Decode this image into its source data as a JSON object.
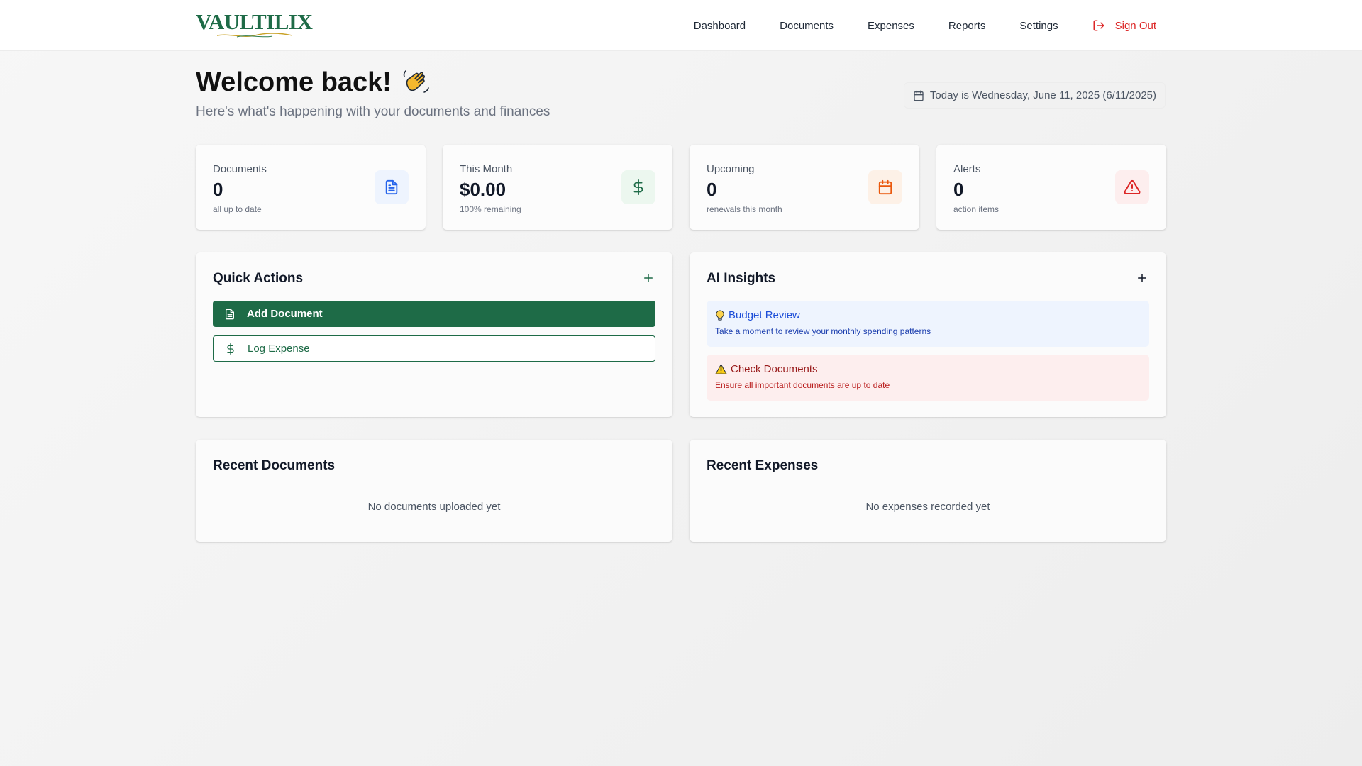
{
  "header": {
    "brand": "VAULTILIX",
    "nav": [
      "Dashboard",
      "Documents",
      "Expenses",
      "Reports",
      "Settings"
    ],
    "signout_label": "Sign Out"
  },
  "welcome": {
    "title": "Welcome back!",
    "subtitle": "Here's what's happening with your documents and finances",
    "date_text": "Today is Wednesday, June 11, 2025 (6/11/2025)"
  },
  "stats": [
    {
      "label": "Documents",
      "value": "0",
      "note": "all up to date",
      "icon": "document-icon",
      "accent": "#2563eb",
      "bg": "#eef4fe"
    },
    {
      "label": "This Month",
      "value": "$0.00",
      "note": "100% remaining",
      "icon": "dollar-icon",
      "accent": "#1e6b47",
      "bg": "#ecf7ef"
    },
    {
      "label": "Upcoming",
      "value": "0",
      "note": "renewals this month",
      "icon": "calendar-icon",
      "accent": "#ea580c",
      "bg": "#fdf1e7"
    },
    {
      "label": "Alerts",
      "value": "0",
      "note": "action items",
      "icon": "alert-triangle-icon",
      "accent": "#dc2626",
      "bg": "#fdeeee"
    }
  ],
  "quick_actions": {
    "title": "Quick Actions",
    "add_document": "Add Document",
    "log_expense": "Log Expense"
  },
  "ai_insights": {
    "title": "AI Insights",
    "items": [
      {
        "title": "Budget Review",
        "body": "Take a moment to review your monthly spending patterns",
        "icon": "lightbulb-icon"
      },
      {
        "title": "Check Documents",
        "body": "Ensure all important documents are up to date",
        "icon": "warning-icon"
      }
    ]
  },
  "recent_documents": {
    "title": "Recent Documents",
    "empty": "No documents uploaded yet"
  },
  "recent_expenses": {
    "title": "Recent Expenses",
    "empty": "No expenses recorded yet"
  },
  "colors": {
    "brand": "#1e6b47",
    "danger": "#dc2626"
  }
}
